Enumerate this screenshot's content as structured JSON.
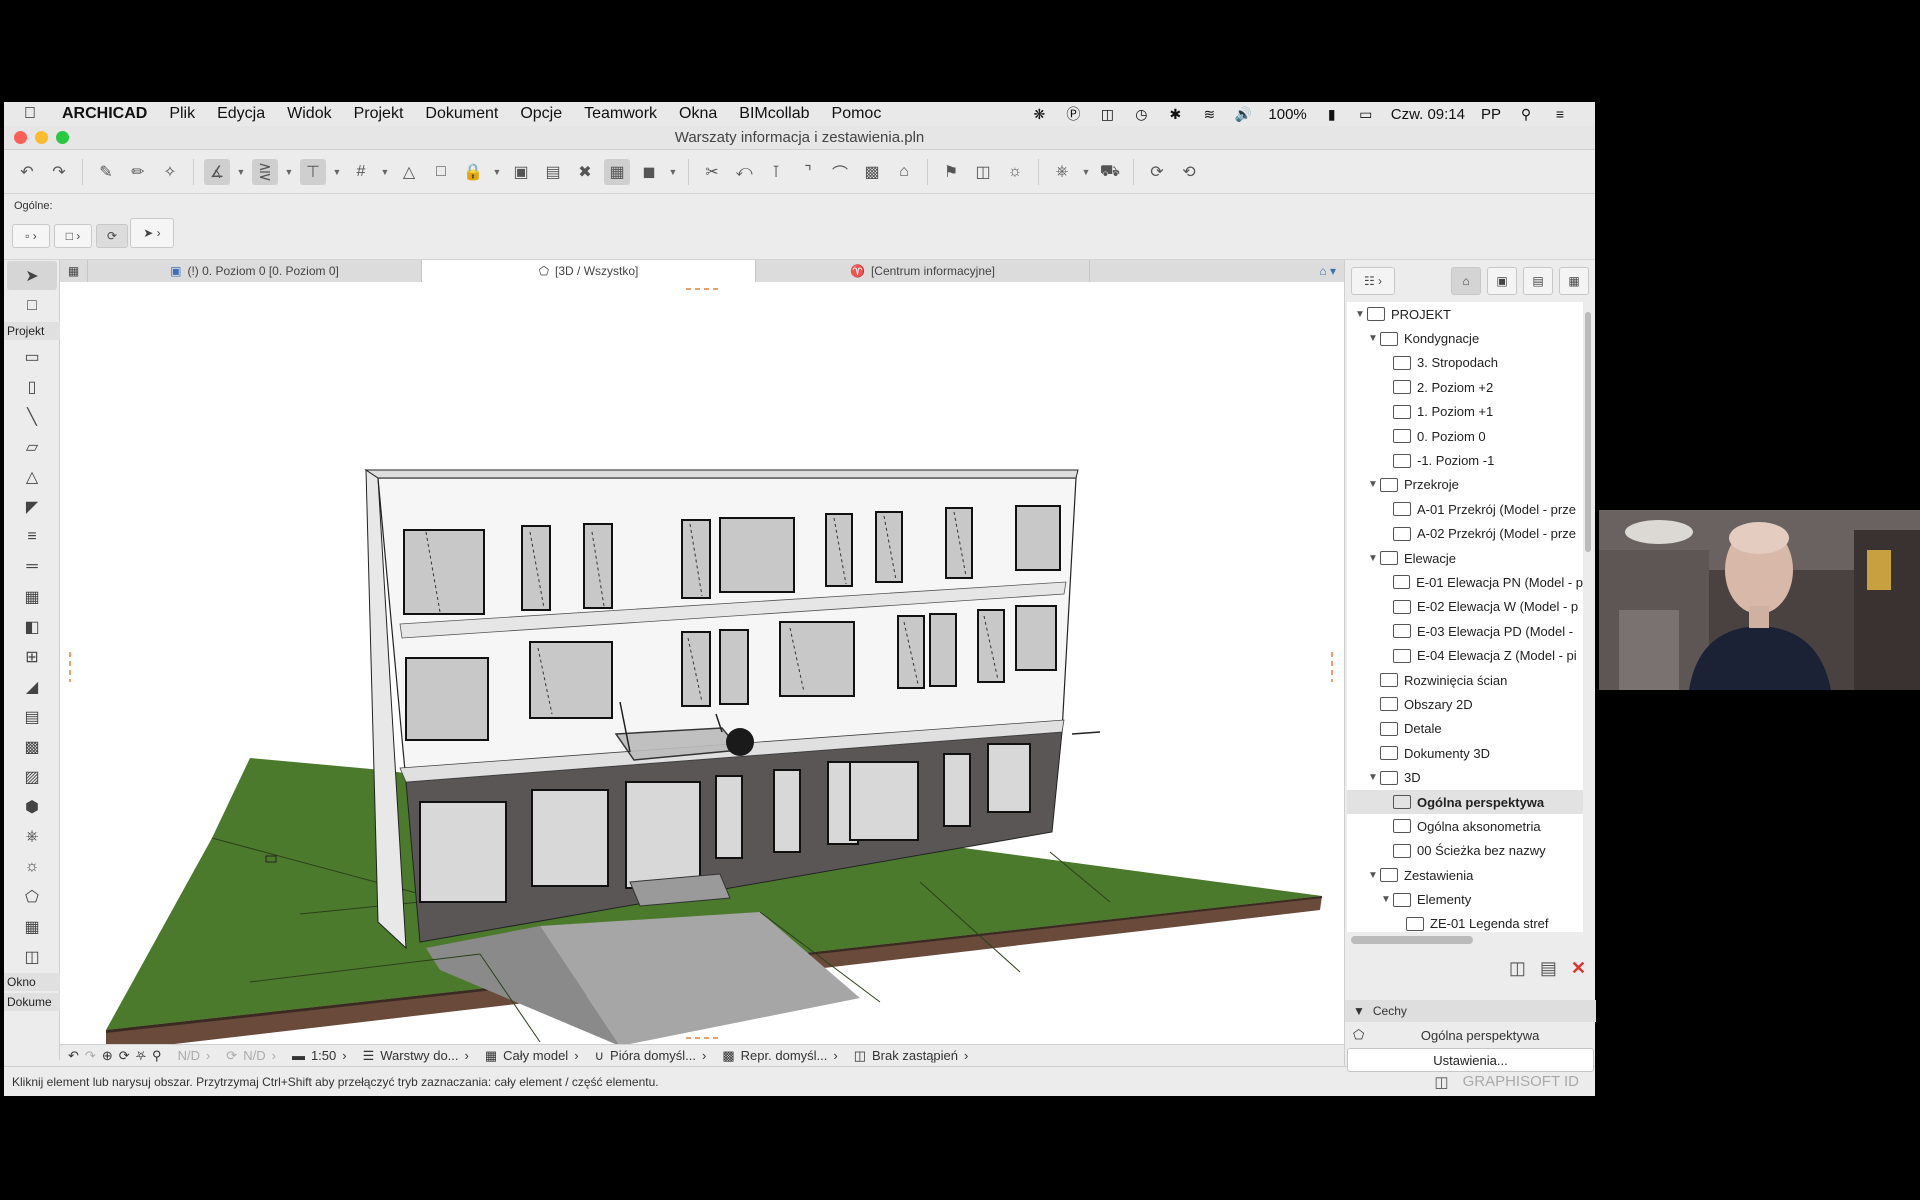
{
  "menubar": {
    "app": "ARCHICAD",
    "items": [
      "Plik",
      "Edycja",
      "Widok",
      "Projekt",
      "Dokument",
      "Opcje",
      "Teamwork",
      "Okna",
      "BIMcollab",
      "Pomoc"
    ],
    "battery": "100%",
    "clock": "Czw. 09:14",
    "user": "PP"
  },
  "window": {
    "title": "Warszaty informacja i zestawienia.pln"
  },
  "infobox": {
    "label": "Ogólne:"
  },
  "toolbox": {
    "section_projekt": "Projekt",
    "section_okno": "Okno",
    "section_dokument": "Dokume"
  },
  "tabs": [
    {
      "label": "(!) 0. Poziom 0 [0. Poziom 0]"
    },
    {
      "label": "[3D / Wszystko]"
    },
    {
      "label": "[Centrum informacyjne]"
    }
  ],
  "viewbar": {
    "nd1": "N/D",
    "nd2": "N/D",
    "scale": "1:50",
    "layers": "Warstwy do...",
    "model": "Cały model",
    "pens": "Pióra domyśl...",
    "repr": "Repr. domyśl...",
    "override": "Brak zastąpień"
  },
  "statusbar": {
    "hint": "Kliknij element lub narysuj obszar. Przytrzymaj Ctrl+Shift aby przełączyć tryb zaznaczania: cały element / część elementu.",
    "brand": "GRAPHISOFT ID"
  },
  "navigator": {
    "tree": [
      {
        "label": "PROJEKT",
        "level": 0,
        "expand": "open"
      },
      {
        "label": "Kondygnacje",
        "level": 1,
        "expand": "open"
      },
      {
        "label": "3. Stropodach",
        "level": 2
      },
      {
        "label": "2. Poziom +2",
        "level": 2
      },
      {
        "label": "1. Poziom +1",
        "level": 2
      },
      {
        "label": "0. Poziom 0",
        "level": 2
      },
      {
        "label": "-1. Poziom -1",
        "level": 2
      },
      {
        "label": "Przekroje",
        "level": 1,
        "expand": "open"
      },
      {
        "label": "A-01 Przekrój (Model - prze",
        "level": 2
      },
      {
        "label": "A-02 Przekrój (Model - prze",
        "level": 2
      },
      {
        "label": "Elewacje",
        "level": 1,
        "expand": "open"
      },
      {
        "label": "E-01 Elewacja PN (Model - p",
        "level": 2
      },
      {
        "label": "E-02 Elewacja W (Model - p",
        "level": 2
      },
      {
        "label": "E-03 Elewacja PD (Model -",
        "level": 2
      },
      {
        "label": "E-04 Elewacja Z (Model - pi",
        "level": 2
      },
      {
        "label": "Rozwinięcia ścian",
        "level": 1
      },
      {
        "label": "Obszary 2D",
        "level": 1
      },
      {
        "label": "Detale",
        "level": 1
      },
      {
        "label": "Dokumenty 3D",
        "level": 1
      },
      {
        "label": "3D",
        "level": 1,
        "expand": "open"
      },
      {
        "label": "Ogólna perspektywa",
        "level": 2,
        "selected": true
      },
      {
        "label": "Ogólna aksonometria",
        "level": 2
      },
      {
        "label": "00 Ścieżka bez nazwy",
        "level": 2
      },
      {
        "label": "Zestawienia",
        "level": 1,
        "expand": "open"
      },
      {
        "label": "Elementy",
        "level": 2,
        "expand": "open"
      },
      {
        "label": "ZE-01 Legenda stref",
        "level": 3
      }
    ],
    "cechy_label": "Cechy",
    "cechy_value": "Ogólna perspektywa",
    "settings_btn": "Ustawienia..."
  },
  "colors": {
    "grass": "#4c7a2c",
    "soil": "#6a4a3a",
    "wall_white": "#f4f4f4",
    "plinth": "#5a5656",
    "delete": "#e0322b"
  }
}
